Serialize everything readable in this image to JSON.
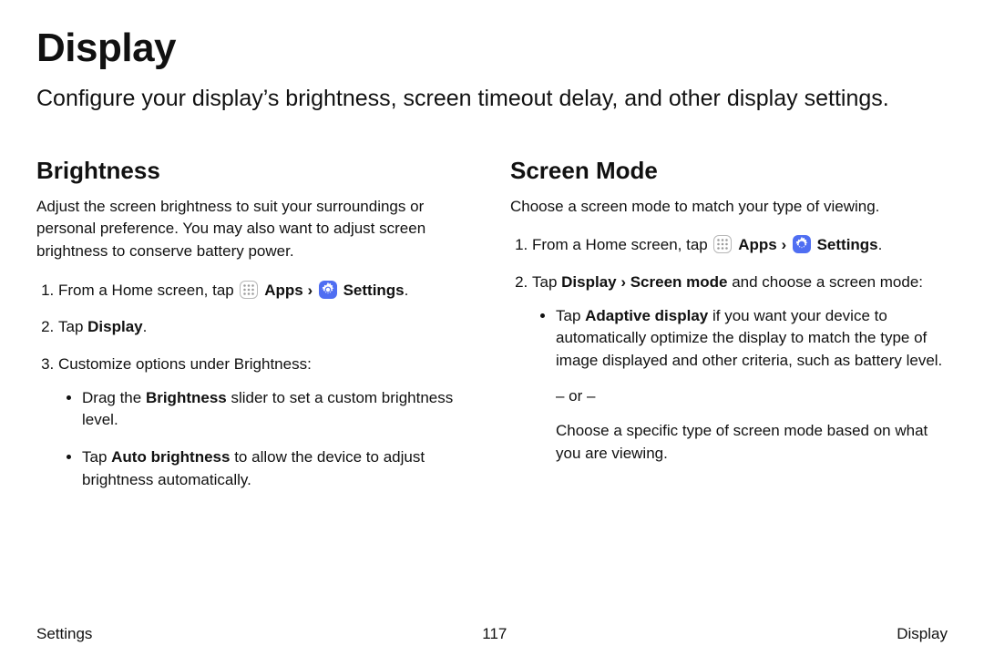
{
  "title": "Display",
  "intro": "Configure your display’s brightness, screen timeout delay, and other display settings.",
  "footer": {
    "left": "Settings",
    "center": "117",
    "right": "Display"
  },
  "labels": {
    "apps": "Apps",
    "settings": "Settings",
    "from_home_pre": "From a Home screen, tap ",
    "chevron": "›",
    "period": "."
  },
  "left": {
    "heading": "Brightness",
    "desc": "Adjust the screen brightness to suit your surroundings or personal preference. You may also want to adjust screen brightness to conserve battery power.",
    "step2_pre": "Tap ",
    "step2_b": "Display",
    "step3": "Customize options under Brightness:",
    "b1_pre": "Drag the ",
    "b1_b": "Brightness",
    "b1_post": " slider to set a custom brightness level.",
    "b2_pre": "Tap ",
    "b2_b": "Auto brightness",
    "b2_post": " to allow the device to adjust brightness automatically."
  },
  "right": {
    "heading": "Screen Mode",
    "desc": "Choose a screen mode to match your type of viewing.",
    "step2_pre": "Tap ",
    "step2_b": "Display › Screen mode",
    "step2_post": " and choose a screen mode:",
    "b1_pre": "Tap ",
    "b1_b": "Adaptive display",
    "b1_post": " if you want your device to automatically optimize the display to match the type of image displayed and other criteria, such as battery level.",
    "or": "– or –",
    "choose": "Choose a specific type of screen mode based on what you are viewing."
  }
}
